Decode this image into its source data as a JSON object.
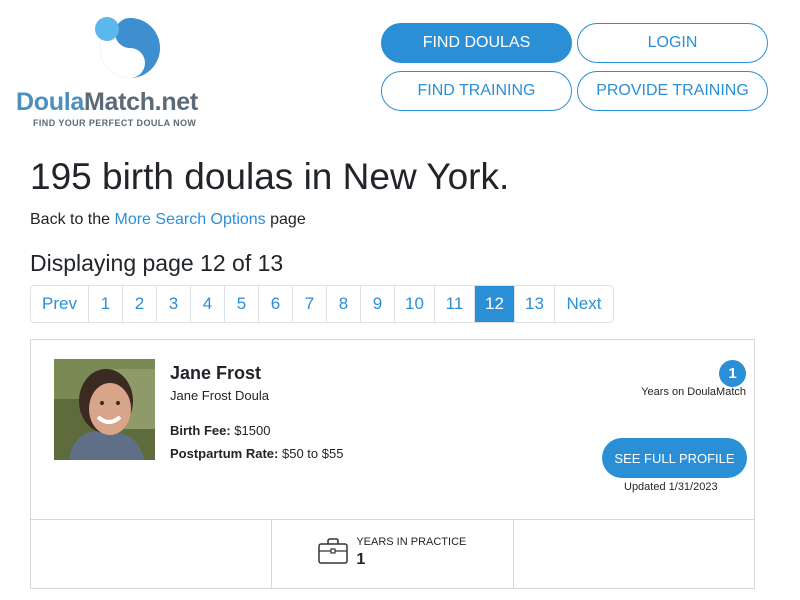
{
  "logo": {
    "name_part1": "Doula",
    "name_part2": "Match.net",
    "tagline": "FIND YOUR PERFECT DOULA NOW"
  },
  "nav": {
    "find_doulas": "FIND DOULAS",
    "login": "LOGIN",
    "find_training": "FIND TRAINING",
    "provide_training": "PROVIDE TRAINING"
  },
  "headline": "195 birth doulas in New York.",
  "back": {
    "prefix": "Back to the ",
    "link": "More Search Options",
    "suffix": " page"
  },
  "displaying": "Displaying page 12 of 13",
  "pagination": {
    "prev": "Prev",
    "pages": [
      "1",
      "2",
      "3",
      "4",
      "5",
      "6",
      "7",
      "8",
      "9",
      "10",
      "11",
      "12",
      "13"
    ],
    "active": "12",
    "next": "Next"
  },
  "listing": {
    "name": "Jane Frost",
    "business": "Jane Frost Doula",
    "birth_fee_label": "Birth Fee:",
    "birth_fee_value": "$1500",
    "postpartum_label": "Postpartum Rate:",
    "postpartum_value": "$50 to $55",
    "years_badge": "1",
    "years_label": "Years on DoulaMatch",
    "profile_button": "SEE FULL PROFILE",
    "updated": "Updated 1/31/2023",
    "stats": {
      "practice_label": "YEARS IN PRACTICE",
      "practice_value": "1"
    }
  },
  "colors": {
    "accent": "#2b8fd6",
    "logo_blue": "#4d8fbd",
    "logo_grey": "#5a6a78"
  },
  "icons": {
    "briefcase": "briefcase-icon"
  }
}
